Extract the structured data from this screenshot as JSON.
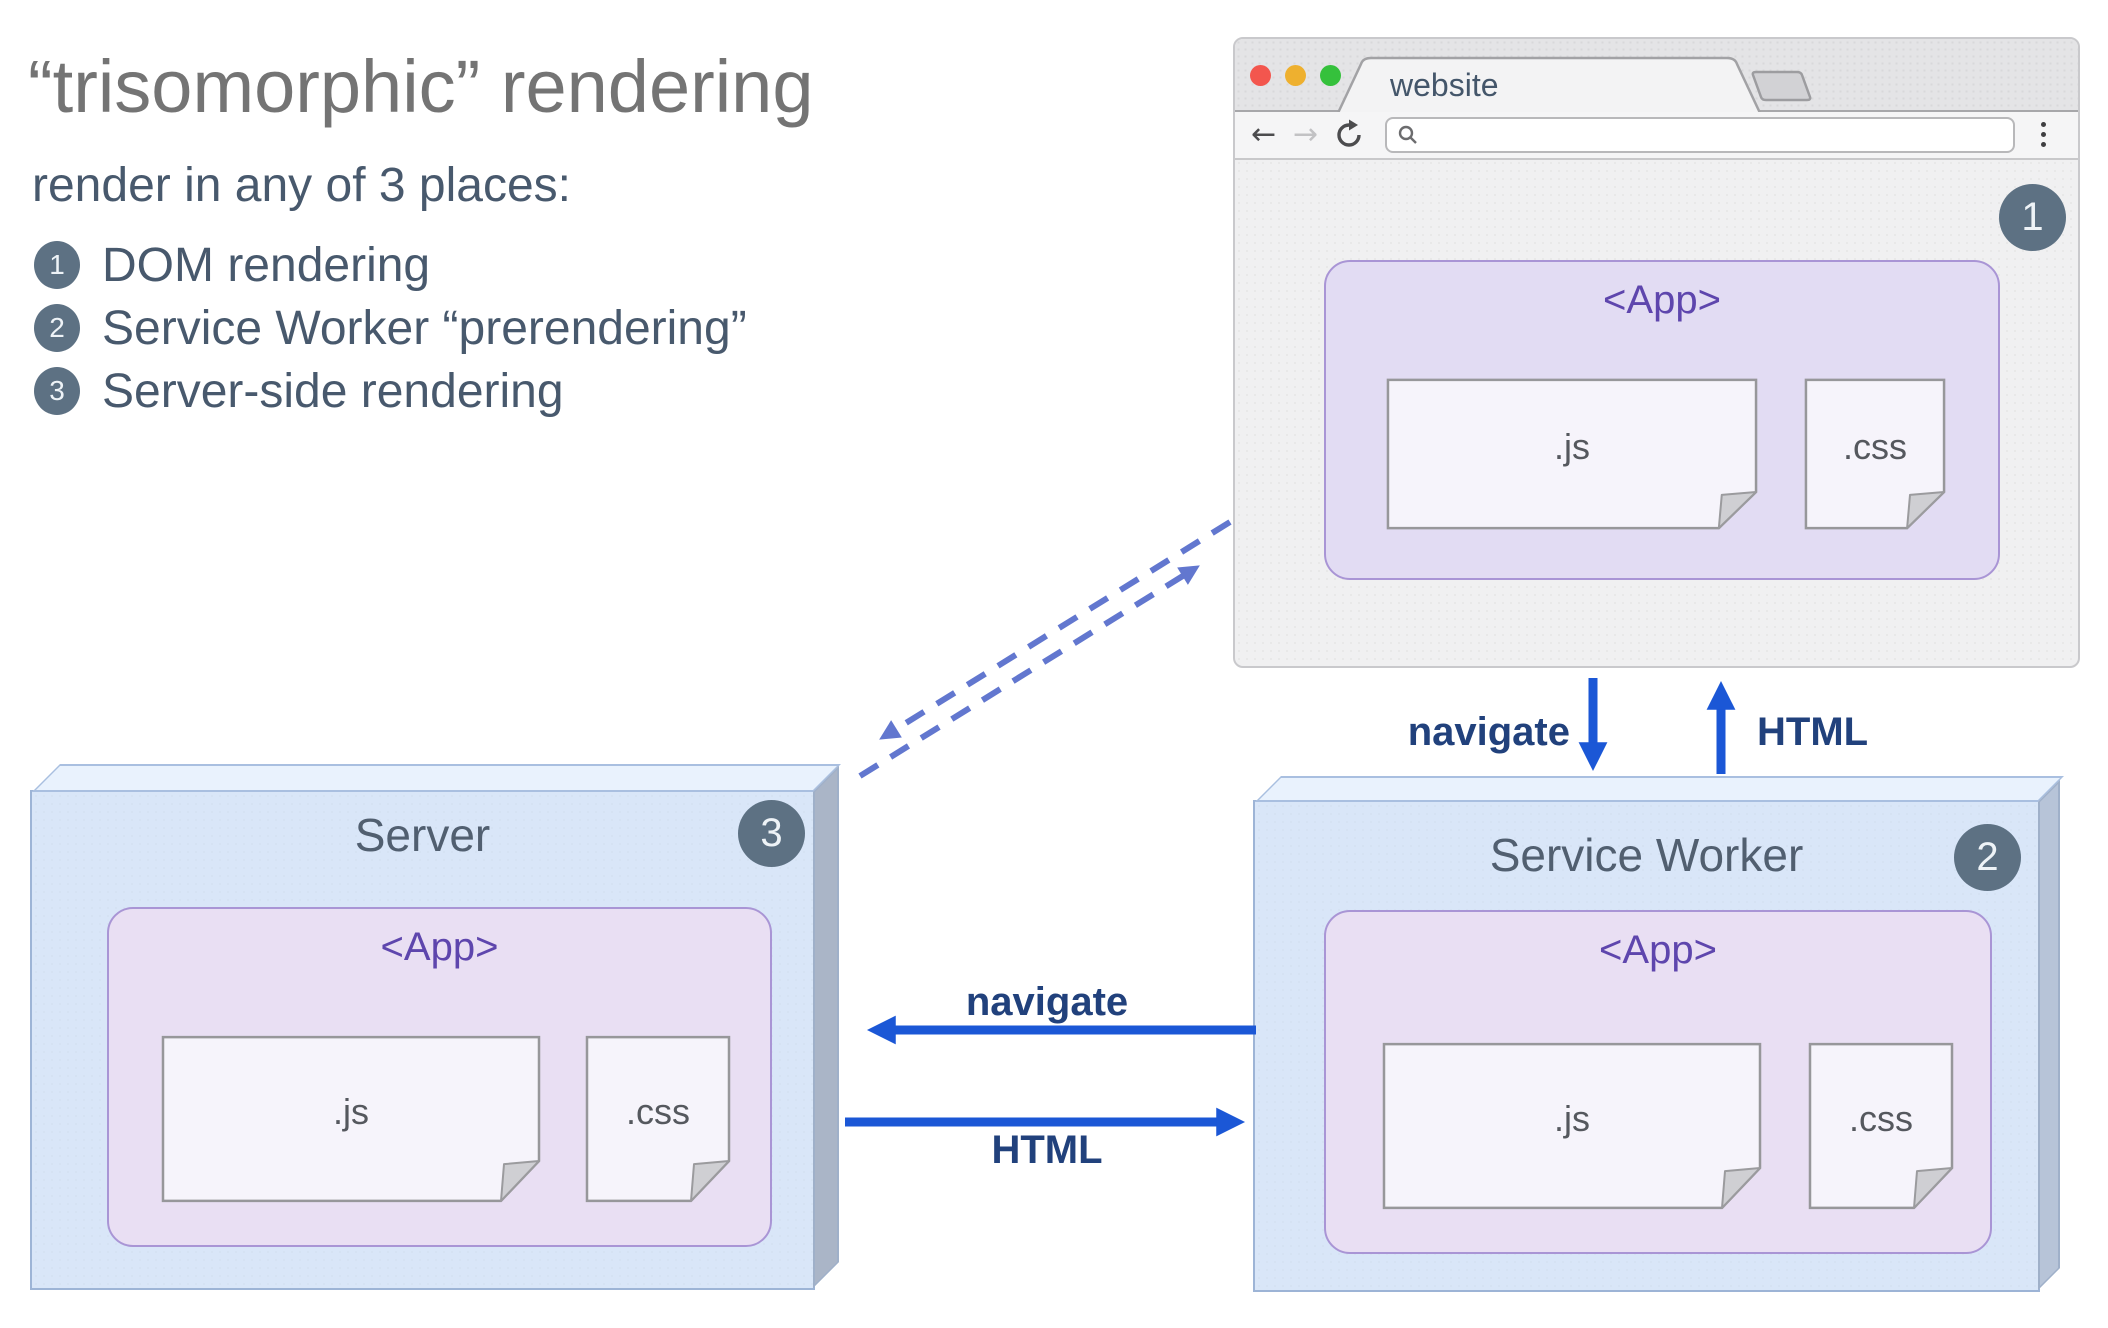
{
  "heading": {
    "title": "“trisomorphic” rendering",
    "subtitle": "render in any of 3 places:"
  },
  "legend": [
    {
      "num": "1",
      "label": "DOM rendering"
    },
    {
      "num": "2",
      "label": "Service Worker “prerendering”"
    },
    {
      "num": "3",
      "label": "Server-side rendering"
    }
  ],
  "browser": {
    "tab_title": "website",
    "badge": "1",
    "back_icon": "←",
    "forward_icon": "→",
    "app": {
      "title": "<App>",
      "js_label": ".js",
      "css_label": ".css"
    }
  },
  "service_worker": {
    "title": "Service Worker",
    "badge": "2",
    "app": {
      "title": "<App>",
      "js_label": ".js",
      "css_label": ".css"
    }
  },
  "server": {
    "title": "Server",
    "badge": "3",
    "app": {
      "title": "<App>",
      "js_label": ".js",
      "css_label": ".css"
    }
  },
  "arrows": {
    "browser_sw": {
      "navigate": "navigate",
      "html": "HTML"
    },
    "server_sw": {
      "navigate": "navigate",
      "html": "HTML"
    }
  },
  "colors": {
    "arrow_blue": "#1b57d6",
    "dashed_blue": "#6277cf",
    "badge_slate": "#5d7183",
    "app_purple": "#5e46ad",
    "box_blue": "#d9e6f8",
    "title_gray": "#747474",
    "text_slate": "#48596d"
  }
}
